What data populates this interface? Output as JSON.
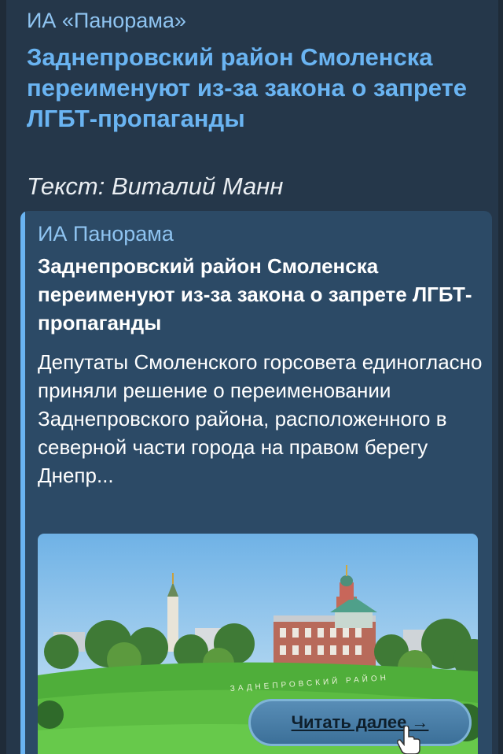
{
  "post": {
    "channel": "ИА «Панорама»",
    "headline": "Заднепровский район Смоленска переименуют из-за закона о запрете ЛГБТ-пропаганды",
    "author": "Текст: Виталий Манн"
  },
  "preview": {
    "site": "ИА Панорама",
    "title": "Заднепровский район Смоленска переименуют из-за закона о запрете ЛГБТ-пропаганды",
    "description": "Депутаты Смоленского горсовета единогласно приняли решение о переименовании Заднепровского района, расположенного в северной части города на правом берегу Днепр...",
    "image_caption": "ЗАДНЕПРОВСКИЙ РАЙОН"
  },
  "actions": {
    "read_more": "Читать далее →"
  },
  "colors": {
    "bubble": "#25374a",
    "accent": "#6ab4f2"
  }
}
